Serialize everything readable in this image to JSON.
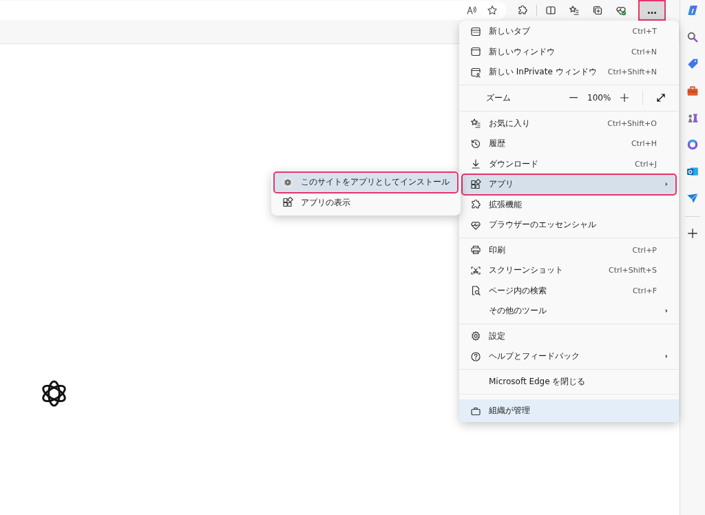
{
  "toolbar": {
    "more_button": {
      "label": "…",
      "annotated": true
    }
  },
  "menu": {
    "sections": [
      [
        {
          "kind": "item",
          "icon": true,
          "label": "新しいタブ",
          "shortcut": "Ctrl+T",
          "submenu": false,
          "selected": false,
          "annotated": false
        },
        {
          "kind": "item",
          "icon": true,
          "label": "新しいウィンドウ",
          "shortcut": "Ctrl+N",
          "submenu": false,
          "selected": false,
          "annotated": false
        },
        {
          "kind": "item",
          "icon": true,
          "label": "新しい InPrivate ウィンドウ",
          "shortcut": "Ctrl+Shift+N",
          "submenu": false,
          "selected": false,
          "annotated": false
        }
      ],
      [
        {
          "kind": "zoom",
          "label": "ズーム",
          "value": "100%"
        }
      ],
      [
        {
          "kind": "item",
          "icon": true,
          "label": "お気に入り",
          "shortcut": "Ctrl+Shift+O",
          "submenu": false,
          "selected": false,
          "annotated": false
        },
        {
          "kind": "item",
          "icon": true,
          "label": "履歴",
          "shortcut": "Ctrl+H",
          "submenu": false,
          "selected": false,
          "annotated": false
        },
        {
          "kind": "item",
          "icon": true,
          "label": "ダウンロード",
          "shortcut": "Ctrl+J",
          "submenu": false,
          "selected": false,
          "annotated": false
        },
        {
          "kind": "item",
          "icon": true,
          "label": "アプリ",
          "submenu": true,
          "selected": true,
          "annotated": true
        },
        {
          "kind": "item",
          "icon": true,
          "label": "拡張機能",
          "submenu": false,
          "selected": false,
          "annotated": false
        },
        {
          "kind": "item",
          "icon": true,
          "label": "ブラウザーのエッセンシャル",
          "submenu": false,
          "selected": false,
          "annotated": false
        }
      ],
      [
        {
          "kind": "item",
          "icon": true,
          "label": "印刷",
          "shortcut": "Ctrl+P",
          "submenu": false,
          "selected": false,
          "annotated": false
        },
        {
          "kind": "item",
          "icon": true,
          "label": "スクリーンショット",
          "shortcut": "Ctrl+Shift+S",
          "submenu": false,
          "selected": false,
          "annotated": false
        },
        {
          "kind": "item",
          "icon": true,
          "label": "ページ内の検索",
          "shortcut": "Ctrl+F",
          "submenu": false,
          "selected": false,
          "annotated": false
        },
        {
          "kind": "item",
          "icon": false,
          "label": "その他のツール",
          "submenu": true,
          "selected": false,
          "annotated": false
        }
      ],
      [
        {
          "kind": "item",
          "icon": true,
          "label": "設定",
          "submenu": false,
          "selected": false,
          "annotated": false
        },
        {
          "kind": "item",
          "icon": true,
          "label": "ヘルプとフィードバック",
          "submenu": true,
          "selected": false,
          "annotated": false
        }
      ],
      [
        {
          "kind": "item",
          "icon": false,
          "label": "Microsoft Edge を閉じる",
          "submenu": false,
          "selected": false,
          "annotated": false
        }
      ],
      [
        {
          "kind": "managed",
          "icon": true,
          "label": "組織が管理"
        }
      ]
    ]
  },
  "submenu": {
    "items": [
      {
        "label": "このサイトをアプリとしてインストール",
        "selected": true,
        "annotated": true
      },
      {
        "label": "アプリの表示",
        "selected": false,
        "annotated": false
      }
    ]
  }
}
